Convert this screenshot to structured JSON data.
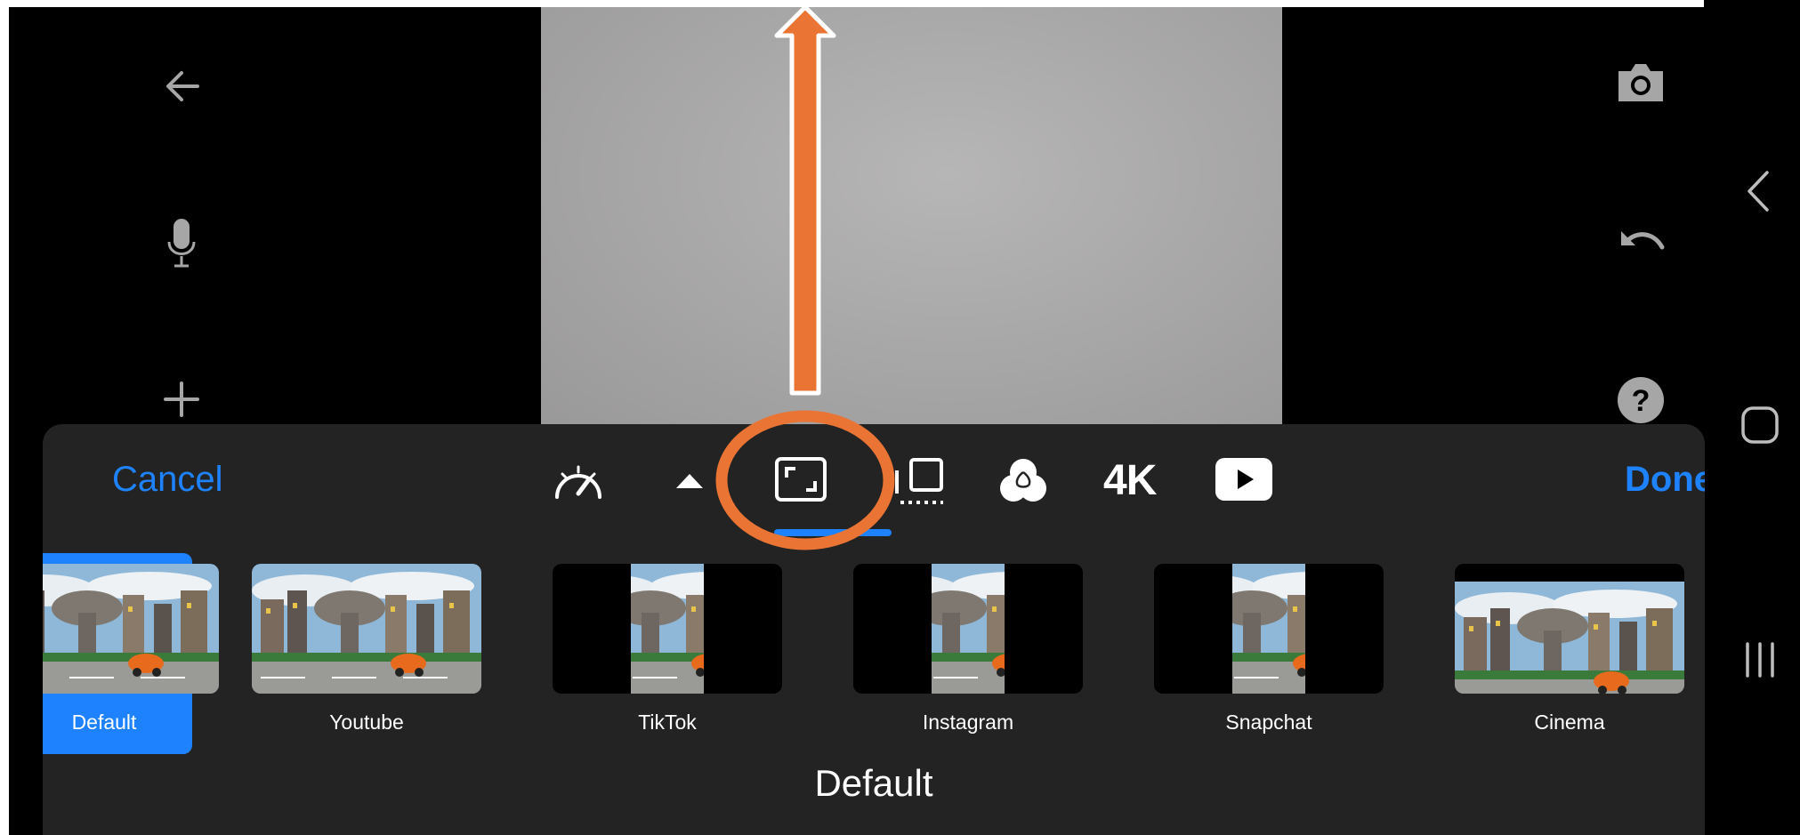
{
  "editor": {
    "left_icons": [
      "back-arrow-icon",
      "microphone-icon",
      "plus-icon"
    ],
    "right_icons": [
      "camera-icon",
      "undo-icon",
      "help-icon"
    ]
  },
  "system_nav": {
    "icons": [
      "nav-back-icon",
      "nav-home-icon",
      "nav-recents-icon"
    ]
  },
  "panel": {
    "cancel_label": "Cancel",
    "done_label": "Done",
    "tools": [
      "speed-icon",
      "collapse-caret-icon",
      "aspect-ratio-icon",
      "frame-icon",
      "color-filter-icon",
      "4K",
      "youtube-play-icon"
    ],
    "presets": [
      {
        "label": "Default",
        "selected": true
      },
      {
        "label": "Youtube"
      },
      {
        "label": "TikTok"
      },
      {
        "label": "Instagram"
      },
      {
        "label": "Snapchat"
      },
      {
        "label": "Cinema"
      }
    ],
    "current_preset": "Default",
    "accent_color": "#1e82ff",
    "annotation_color": "#ea7434"
  }
}
